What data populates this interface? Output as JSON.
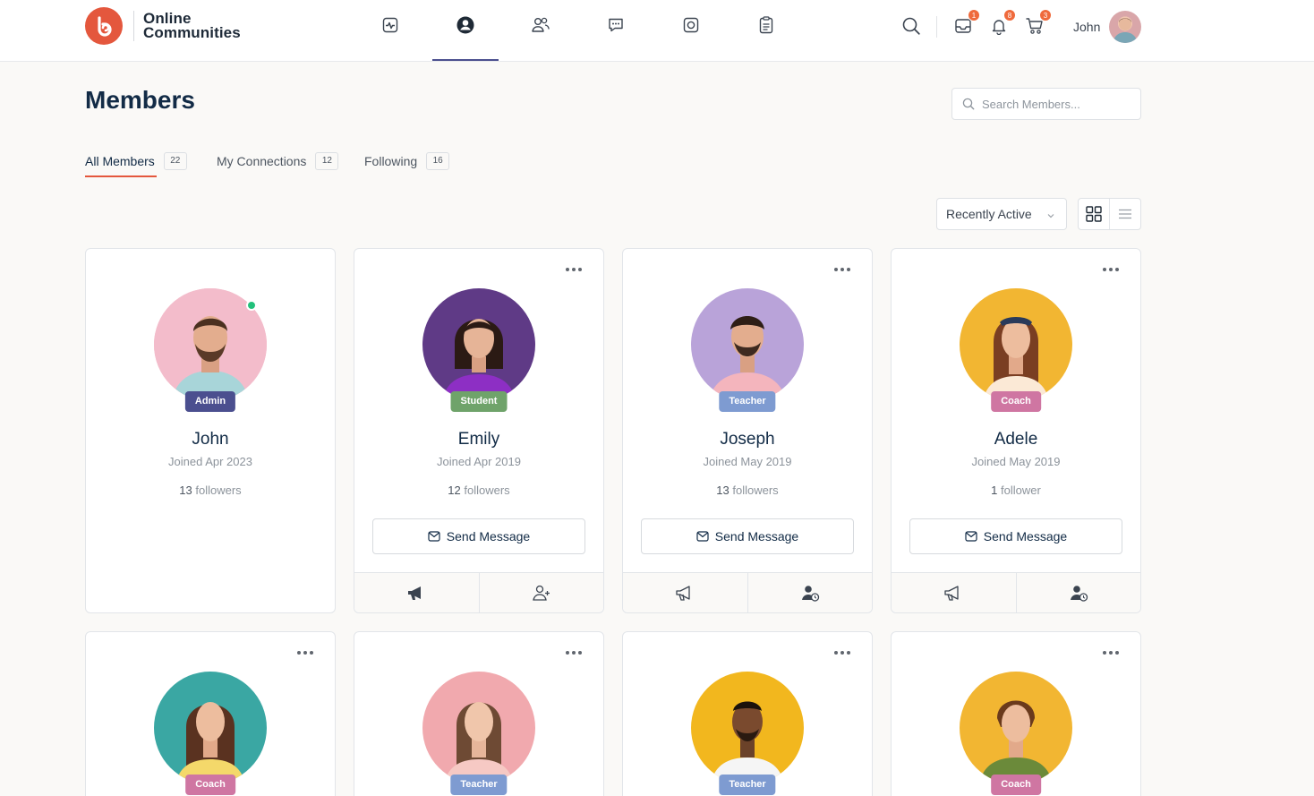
{
  "header": {
    "logo_line1": "Online",
    "logo_line2": "Communities",
    "nav": [
      "activity-icon",
      "profile-icon",
      "groups-icon",
      "forums-icon",
      "photos-icon",
      "documents-icon"
    ],
    "badges": {
      "messages": "1",
      "notifications": "8",
      "cart": "3"
    },
    "user_name": "John"
  },
  "page": {
    "title": "Members",
    "search_placeholder": "Search Members..."
  },
  "tabs": [
    {
      "label": "All Members",
      "count": "22"
    },
    {
      "label": "My Connections",
      "count": "12"
    },
    {
      "label": "Following",
      "count": "16"
    }
  ],
  "sort": {
    "selected": "Recently Active"
  },
  "members": [
    {
      "name": "John",
      "role": "Admin",
      "joined": "Joined Apr 2023",
      "followers_count": "13",
      "followers_label": "followers",
      "button": ""
    },
    {
      "name": "Emily",
      "role": "Student",
      "joined": "Joined Apr 2019",
      "followers_count": "12",
      "followers_label": "followers",
      "button": "Send Message"
    },
    {
      "name": "Joseph",
      "role": "Teacher",
      "joined": "Joined May 2019",
      "followers_count": "13",
      "followers_label": "followers",
      "button": "Send Message"
    },
    {
      "name": "Adele",
      "role": "Coach",
      "joined": "Joined May 2019",
      "followers_count": "1",
      "followers_label": "follower",
      "button": "Send Message"
    },
    {
      "role": "Coach"
    },
    {
      "role": "Teacher"
    },
    {
      "role": "Teacher"
    },
    {
      "role": "Coach"
    }
  ],
  "colors": {
    "accent": "#e4573d",
    "admin": "#4b4f8f",
    "student": "#6fa36a",
    "teacher": "#7e9bd1",
    "coach": "#cf76a2"
  }
}
